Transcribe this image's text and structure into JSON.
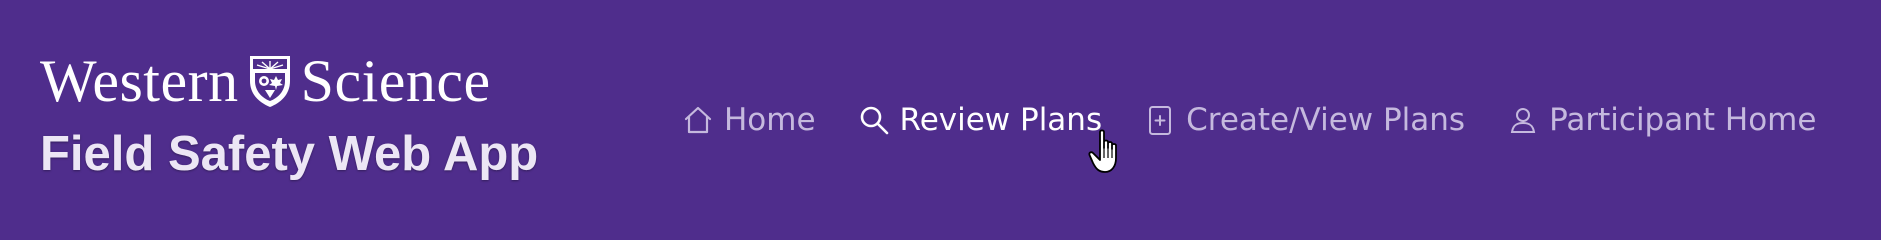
{
  "brand": {
    "logo_left": "Western",
    "logo_right": "Science",
    "app_title": "Field Safety Web App"
  },
  "nav": {
    "items": [
      {
        "label": "Home",
        "icon": "home-icon",
        "active": false
      },
      {
        "label": "Review Plans",
        "icon": "search-icon",
        "active": true
      },
      {
        "label": "Create/View Plans",
        "icon": "add-document-icon",
        "active": false
      },
      {
        "label": "Participant Home",
        "icon": "person-icon",
        "active": false
      }
    ]
  },
  "colors": {
    "background": "#4f2d8c",
    "nav_text": "#c5b9de",
    "nav_active": "#ffffff",
    "title_text": "#ece6f5"
  }
}
